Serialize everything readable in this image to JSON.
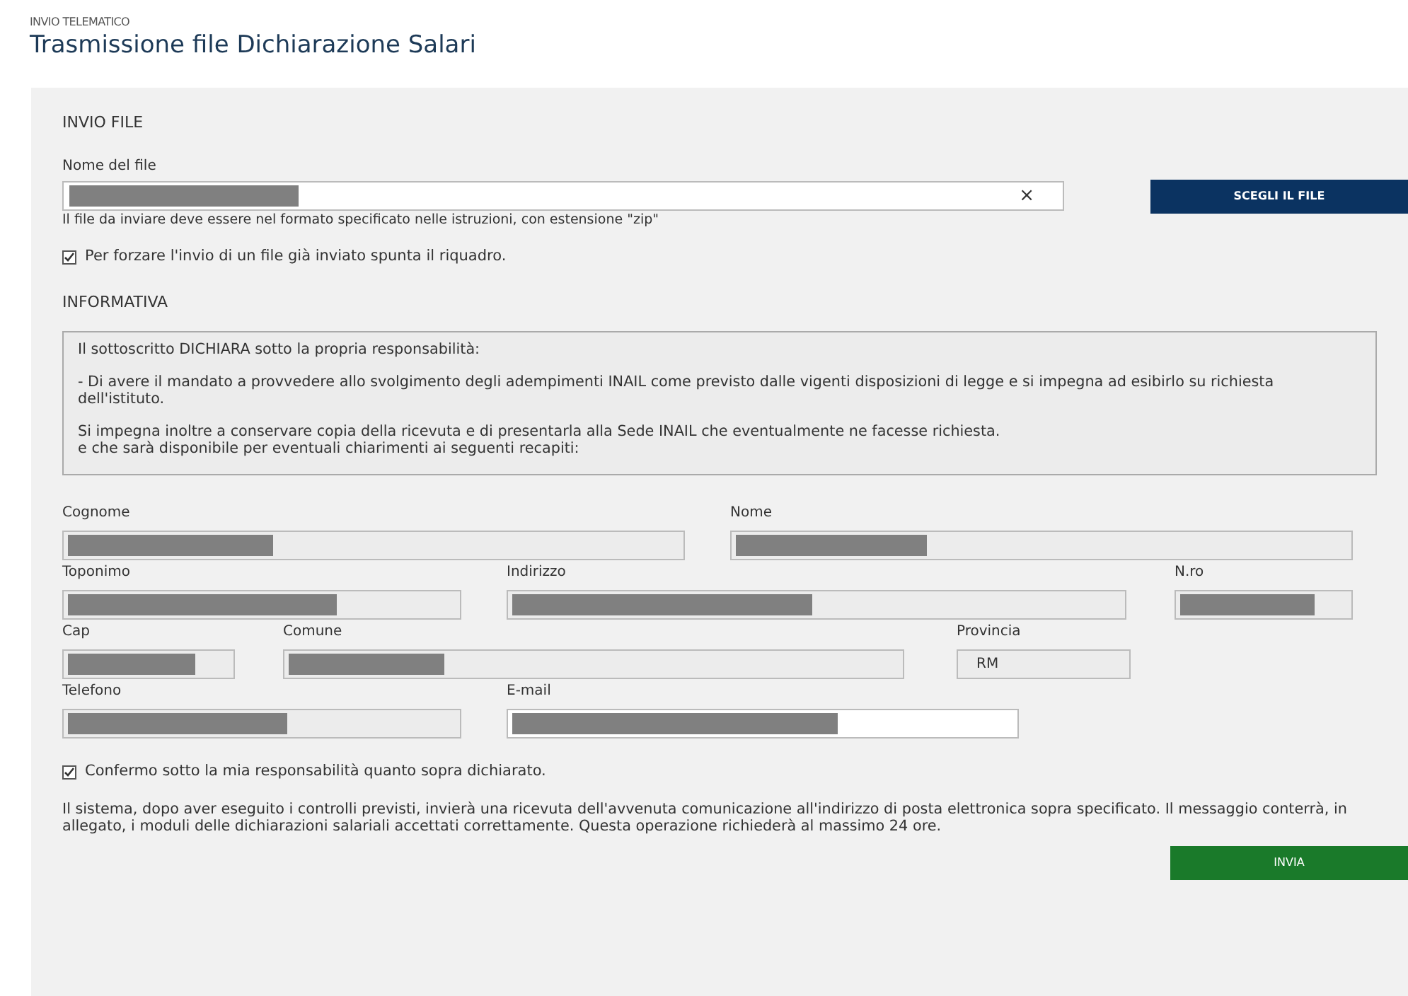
{
  "header": {
    "overline": "INVIO TELEMATICO",
    "title": "Trasmissione file Dichiarazione Salari"
  },
  "file_section": {
    "heading": "INVIO FILE",
    "label": "Nome del file",
    "value_redacted": true,
    "clear": "×",
    "hint": "Il file da inviare deve essere nel formato specificato nelle istruzioni, con estensione \"zip\"",
    "button": "SCEGLI IL FILE",
    "force": {
      "label": "Per forzare l'invio di un file già inviato spunta il riquadro.",
      "checked": true
    }
  },
  "informativa": {
    "heading": "INFORMATIVA",
    "paragraphs": [
      "Il sottoscritto DICHIARA sotto la propria responsabilità:",
      "- Di avere il mandato a provvedere allo svolgimento degli adempimenti INAIL come previsto dalle vigenti disposizioni di legge e si impegna ad esibirlo su richiesta dell'istituto.",
      "Si impegna inoltre a conservare copia della ricevuta e di presentarla alla Sede INAIL che eventualmente ne facesse richiesta.\ne che sarà disponibile per eventuali chiarimenti ai seguenti recapiti:"
    ]
  },
  "contact_rows": [
    [
      {
        "label": "Cognome",
        "redacted": true,
        "editable": false
      },
      {
        "label": "Nome",
        "redacted": true,
        "editable": false
      }
    ],
    [
      {
        "label": "Toponimo",
        "redacted": true,
        "editable": false
      },
      {
        "label": "Indirizzo",
        "redacted": true,
        "editable": false
      },
      {
        "label": "N.ro",
        "redacted": true,
        "editable": false
      }
    ],
    [
      {
        "label": "Cap",
        "redacted": true,
        "editable": false
      },
      {
        "label": "Comune",
        "redacted": true,
        "editable": false
      },
      {
        "label": "Provincia",
        "value": "RM",
        "redacted": false,
        "editable": false
      }
    ],
    [
      {
        "label": "Telefono",
        "redacted": true,
        "editable": false
      },
      {
        "label": "E-mail",
        "redacted": true,
        "editable": true
      }
    ]
  ],
  "confirm": {
    "label": "Confermo sotto la mia responsabilità quanto sopra dichiarato.",
    "checked": true
  },
  "notice": "Il sistema, dopo aver eseguito i controlli previsti, invierà una ricevuta dell'avvenuta comunicazione all'indirizzo di posta elettronica sopra specificato. Il messaggio conterrà, in allegato, i moduli delle dichiarazioni salariali accettati correttamente. Questa operazione richiederà al massimo 24 ore.",
  "submit": "INVIA"
}
